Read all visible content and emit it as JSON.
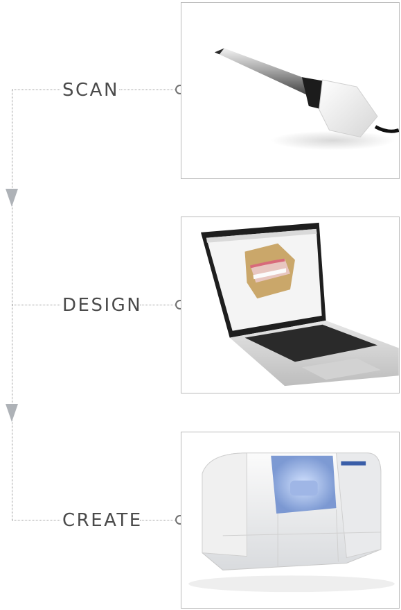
{
  "steps": [
    {
      "label": "SCAN",
      "image": "intraoral-scanner-wand"
    },
    {
      "label": "DESIGN",
      "image": "laptop-with-3d-denture-model"
    },
    {
      "label": "CREATE",
      "image": "milling-machine"
    }
  ],
  "colors": {
    "line": "#9a9a9a",
    "label_text": "#4a4a4a",
    "arrow": "#aeb2b7",
    "frame_border": "#b9b9b9"
  }
}
